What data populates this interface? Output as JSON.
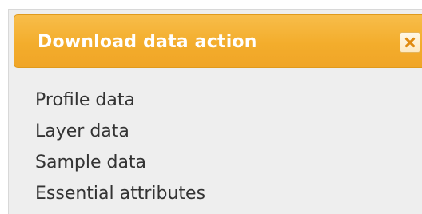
{
  "dialog": {
    "title": "Download data action",
    "close_icon": "close-icon",
    "items": [
      {
        "label": "Profile data"
      },
      {
        "label": "Layer data"
      },
      {
        "label": "Sample data"
      },
      {
        "label": "Essential attributes"
      }
    ]
  },
  "colors": {
    "titlebar": "#f3ad2c",
    "title_text": "#ffffff",
    "body_background": "#eeeeee",
    "item_text": "#333333",
    "close_icon": "#e08a10"
  }
}
